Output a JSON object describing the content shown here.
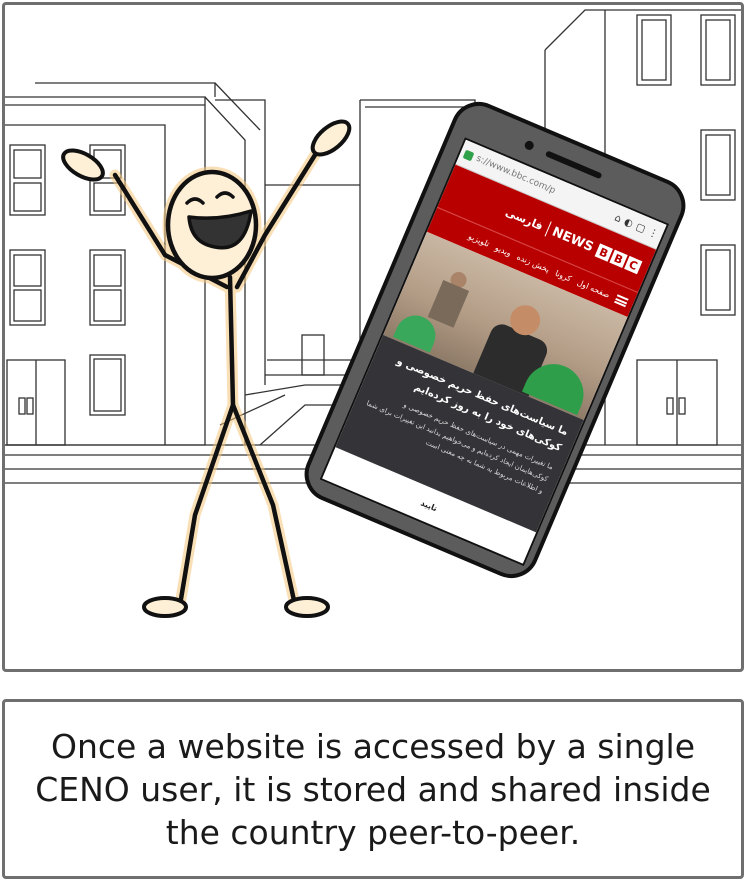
{
  "phone": {
    "url": "s://www.bbc.com/p",
    "brand": {
      "b1": "B",
      "b2": "B",
      "b3": "C",
      "news": "NEWS",
      "lang": "فارسی"
    },
    "nav": [
      "صفحه اول",
      "کرونا",
      "پخش زنده",
      "ویدیو",
      "تلویزیو"
    ],
    "consent": {
      "title": "ما سیاست‌های حفظ حریم خصوصی و کوکی‌های خود را به روز کرده‌ایم",
      "body": "ما تغییرات مهمی در سیاست‌های حفظ حریم خصوصی و کوکی‌هایمان ایجاد کرده‌ایم و می‌خواهیم بدانید این تغییرات برای شما و اطلاعات مربوط به شما به چه معنی است",
      "button": "تایید"
    }
  },
  "caption": {
    "line1": "Once a website is accessed by a single",
    "line2": "CENO user, it is stored and shared inside",
    "line3": "the country peer-to-peer."
  },
  "colors": {
    "frame": "#6f6f6f",
    "bbc_red": "#b80000",
    "skin": "#fdf0d6",
    "glow": "#f5c67a",
    "phone_body": "#5c5c5c",
    "consent_bg": "#333338"
  }
}
